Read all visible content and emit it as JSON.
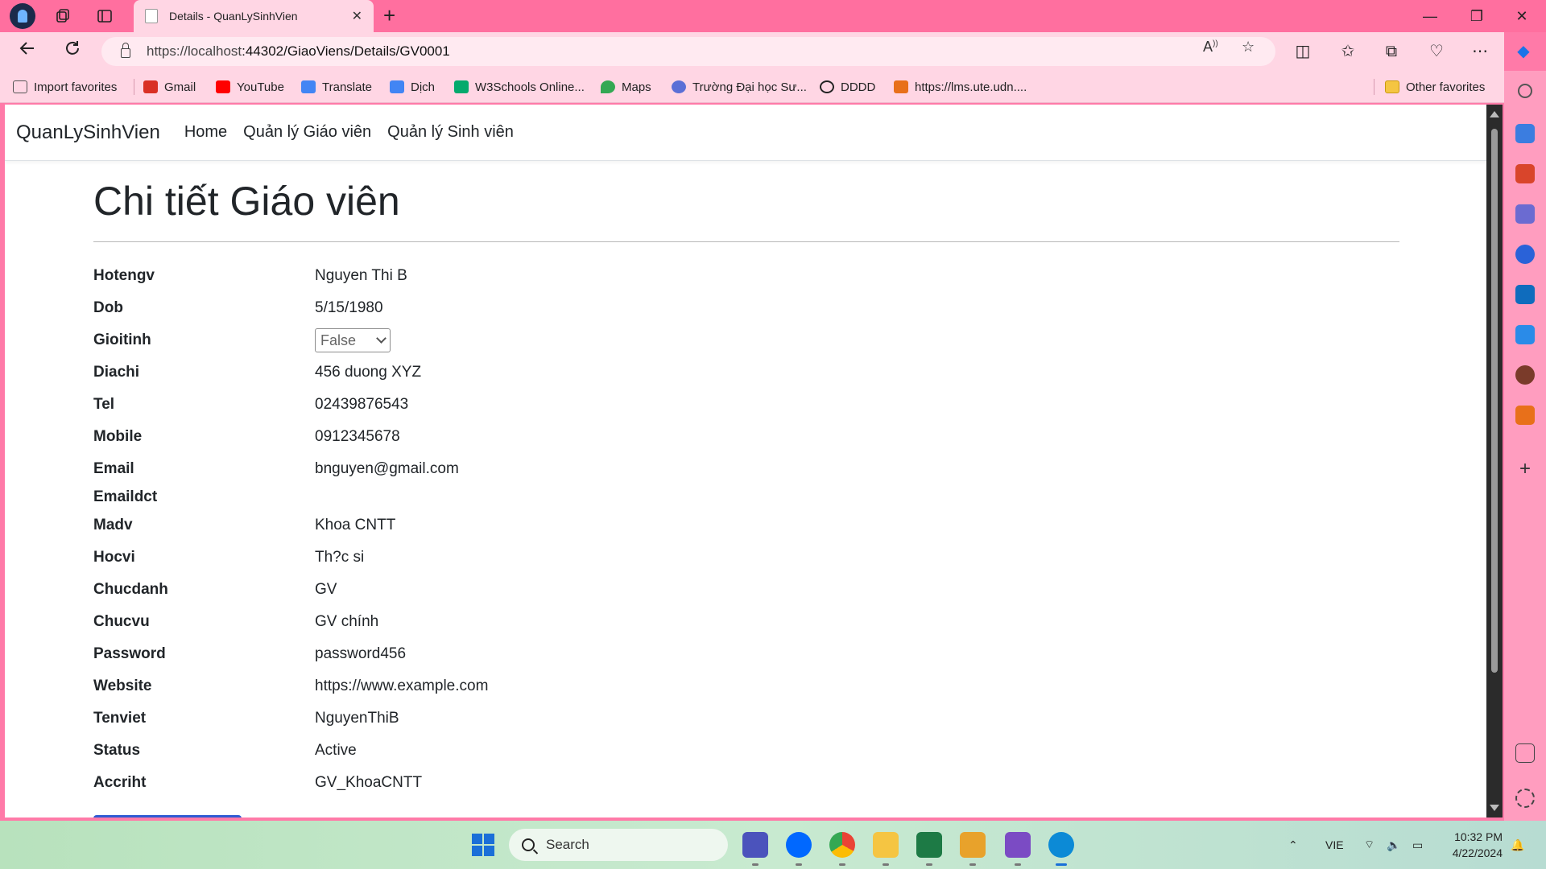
{
  "browser": {
    "tab_title": "Details - QuanLySinhVien",
    "tab_close": "✕",
    "new_tab": "+",
    "url_host": "https://localhost",
    "url_rest": ":44302/GiaoViens/Details/GV0001",
    "window_min": "—",
    "window_restore": "❐",
    "window_close": "✕"
  },
  "favorites": [
    {
      "label": "Import favorites",
      "color": "#555555"
    },
    {
      "label": "Gmail",
      "color": "#d93025"
    },
    {
      "label": "YouTube",
      "color": "#ff0000"
    },
    {
      "label": "Translate",
      "color": "#4285f4"
    },
    {
      "label": "Dịch",
      "color": "#4285f4"
    },
    {
      "label": "W3Schools Online...",
      "color": "#04aa6d"
    },
    {
      "label": "Maps",
      "color": "#34a853"
    },
    {
      "label": "Trường Đại học Sư...",
      "color": "#5b6fd6"
    },
    {
      "label": "DDDD",
      "color": "#222222"
    },
    {
      "label": "https://lms.ute.udn....",
      "color": "#e8701a"
    }
  ],
  "other_favorites": "Other favorites",
  "app": {
    "brand": "QuanLySinhVien",
    "nav": [
      "Home",
      "Quản lý Giáo viên",
      "Quản lý Sinh viên"
    ],
    "page_title": "Chi tiết Giáo viên"
  },
  "details": [
    {
      "label": "Hotengv",
      "value": "Nguyen Thi B"
    },
    {
      "label": "Dob",
      "value": "5/15/1980"
    },
    {
      "label": "Gioitinh",
      "value": "False"
    },
    {
      "label": "Diachi",
      "value": "456 duong XYZ"
    },
    {
      "label": "Tel",
      "value": "02439876543"
    },
    {
      "label": "Mobile",
      "value": "0912345678"
    },
    {
      "label": "Email",
      "value": "bnguyen@gmail.com"
    },
    {
      "label": "Emaildct",
      "value": ""
    },
    {
      "label": "Madv",
      "value": "Khoa CNTT"
    },
    {
      "label": "Hocvi",
      "value": "Th?c si"
    },
    {
      "label": "Chucdanh",
      "value": "GV"
    },
    {
      "label": "Chucvu",
      "value": "GV chính"
    },
    {
      "label": "Password",
      "value": "password456"
    },
    {
      "label": "Website",
      "value": "https://www.example.com"
    },
    {
      "label": "Tenviet",
      "value": "NguyenThiB"
    },
    {
      "label": "Status",
      "value": "Active"
    },
    {
      "label": "Accriht",
      "value": "GV_KhoaCNTT"
    }
  ],
  "taskbar": {
    "search_placeholder": "Search",
    "lang": "VIE",
    "time": "10:32 PM",
    "date": "4/22/2024"
  },
  "colors": {
    "browser_frame": "#ff6f9f",
    "toolbar": "#ffd6e4",
    "sidebar": "#ff9dbf",
    "link_accent": "#2f5bd3"
  }
}
